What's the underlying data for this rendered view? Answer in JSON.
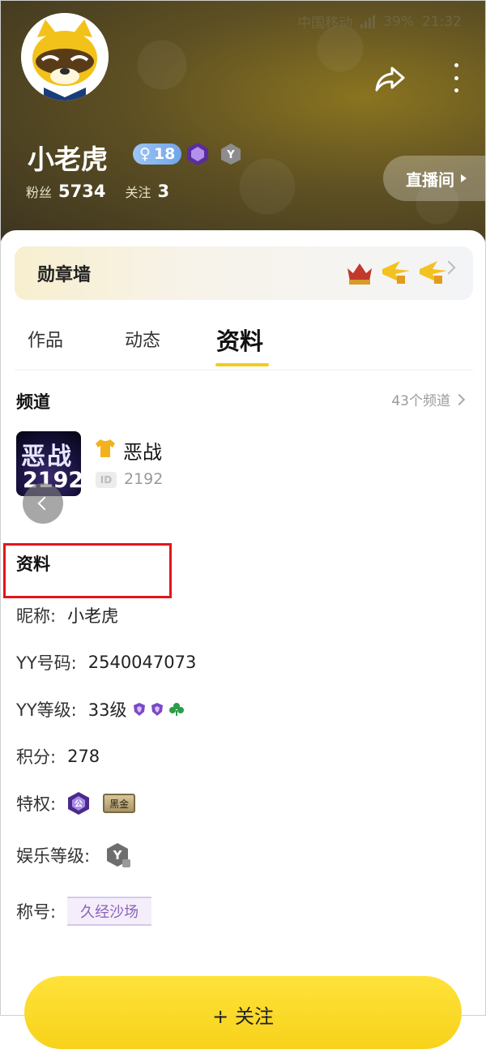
{
  "status_bar": {
    "carrier": "中国移动",
    "battery": "39%",
    "time": "21:32"
  },
  "profile": {
    "username": "小老虎",
    "level": "18",
    "fans_label": "粉丝",
    "fans_count": "5734",
    "follow_label": "关注",
    "follow_count": "3",
    "live_room_label": "直播间"
  },
  "medal_wall": {
    "label": "勋章墙"
  },
  "tabs": [
    {
      "label": "作品",
      "active": false
    },
    {
      "label": "动态",
      "active": false
    },
    {
      "label": "资料",
      "active": true
    }
  ],
  "channel": {
    "section_title": "频道",
    "count_label": "43个频道",
    "cover_top_text": "恶战",
    "cover_num_text": "2192",
    "name": "恶战",
    "id_badge": "ID",
    "id": "2192"
  },
  "info": {
    "section_title": "资料",
    "nickname_label": "昵称:",
    "nickname": "小老虎",
    "yy_number_label": "YY号码:",
    "yy_number": "2540047073",
    "yy_level_label": "YY等级:",
    "yy_level": "33级",
    "points_label": "积分:",
    "points": "278",
    "privilege_label": "特权:",
    "privilege_badge_text": "公",
    "privilege_tag_text": "黑金",
    "ent_level_label": "娱乐等级:",
    "title_label": "称号:",
    "title_tag": "久经沙场"
  },
  "follow_button": {
    "label": "+ 关注"
  },
  "colors": {
    "accent_yellow": "#f5cb1c",
    "highlight_red": "#e0161c",
    "tag_purple": "#8a63b8"
  }
}
